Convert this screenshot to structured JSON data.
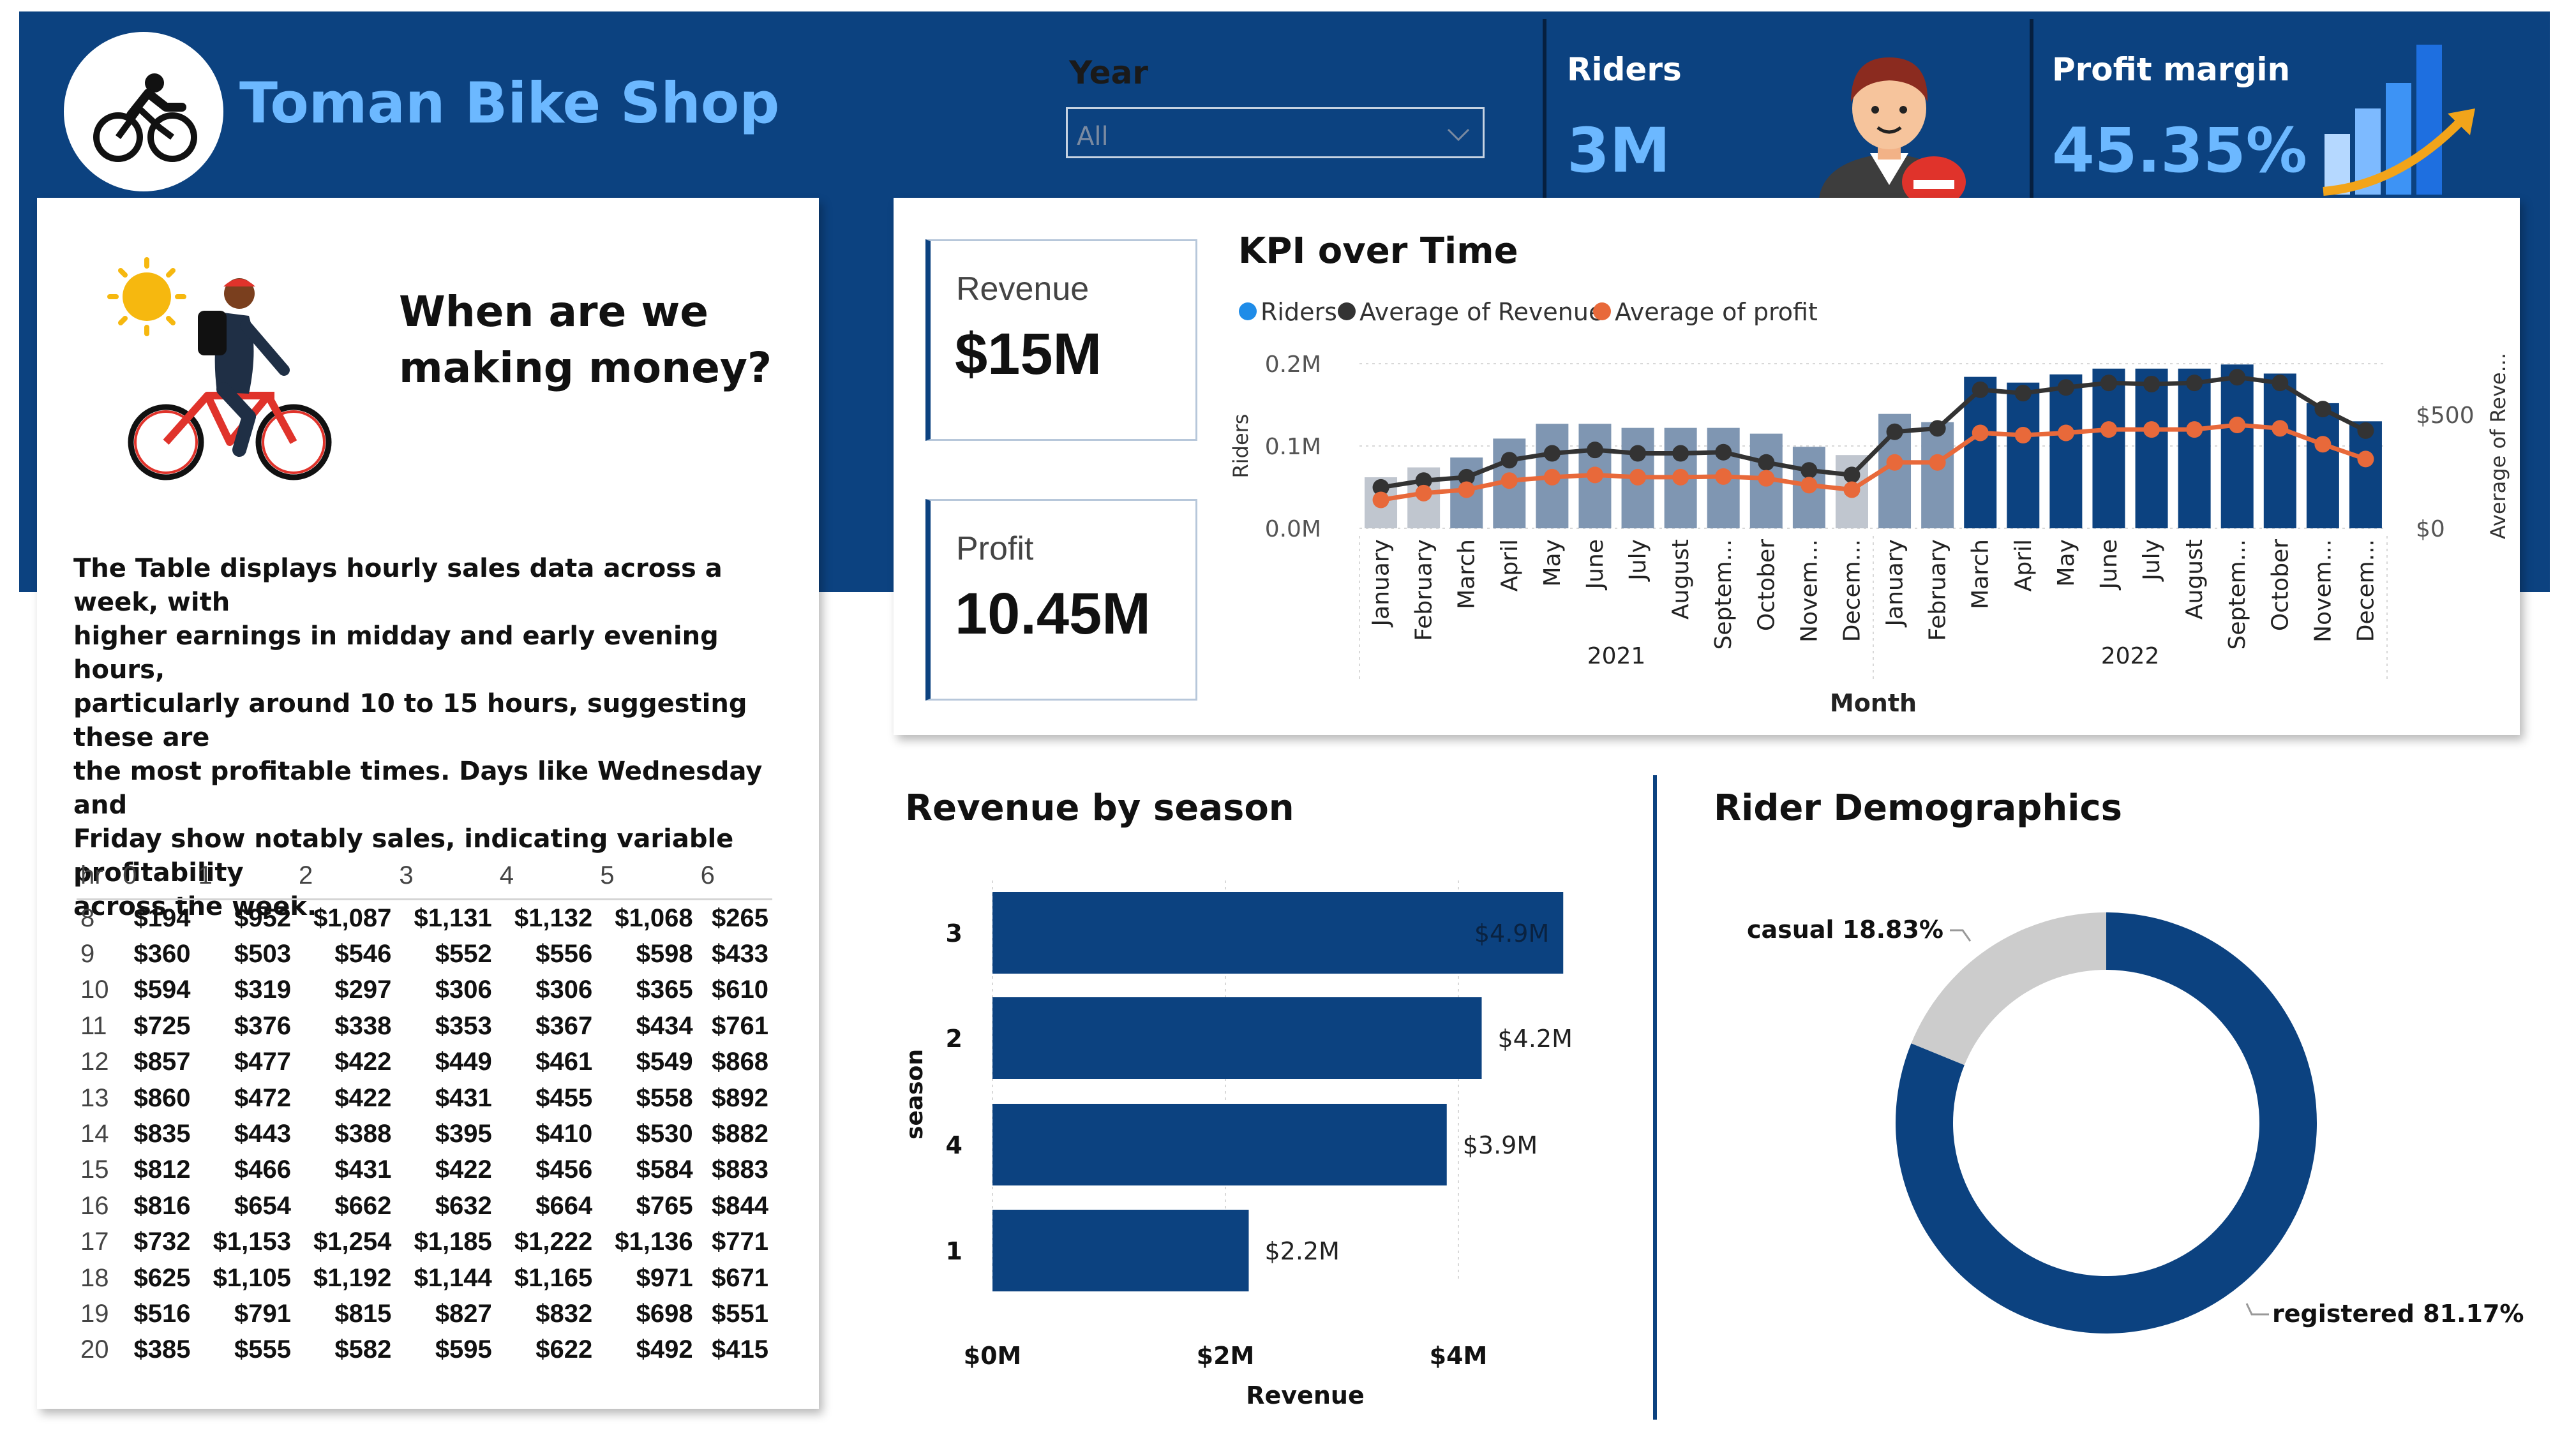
{
  "app": {
    "title": "Toman Bike Shop"
  },
  "slicer": {
    "label": "Year",
    "value": "All"
  },
  "kpis": {
    "riders": {
      "title": "Riders",
      "value": "3M"
    },
    "profit_margin": {
      "title": "Profit margin",
      "value": "45.35%"
    },
    "revenue": {
      "title": "Revenue",
      "value": "$15M"
    },
    "profit": {
      "title": "Profit",
      "value": "10.45M"
    }
  },
  "left_panel": {
    "heading_line1": "When are we",
    "heading_line2": "making money?",
    "description": [
      "The Table displays hourly sales data across a week, with",
      "higher earnings in midday and early evening hours,",
      "particularly around 10 to 15 hours, suggesting these are",
      "the most profitable times. Days like Wednesday and",
      "Friday show notably sales, indicating variable profitability",
      "across the week."
    ]
  },
  "hourly_table": {
    "header": [
      "hr",
      "0",
      "1",
      "2",
      "3",
      "4",
      "5",
      "6"
    ],
    "rows": [
      [
        "8",
        "$194",
        "$952",
        "$1,087",
        "$1,131",
        "$1,132",
        "$1,068",
        "$265"
      ],
      [
        "9",
        "$360",
        "$503",
        "$546",
        "$552",
        "$556",
        "$598",
        "$433"
      ],
      [
        "10",
        "$594",
        "$319",
        "$297",
        "$306",
        "$306",
        "$365",
        "$610"
      ],
      [
        "11",
        "$725",
        "$376",
        "$338",
        "$353",
        "$367",
        "$434",
        "$761"
      ],
      [
        "12",
        "$857",
        "$477",
        "$422",
        "$449",
        "$461",
        "$549",
        "$868"
      ],
      [
        "13",
        "$860",
        "$472",
        "$422",
        "$431",
        "$455",
        "$558",
        "$892"
      ],
      [
        "14",
        "$835",
        "$443",
        "$388",
        "$395",
        "$410",
        "$530",
        "$882"
      ],
      [
        "15",
        "$812",
        "$466",
        "$431",
        "$422",
        "$456",
        "$584",
        "$883"
      ],
      [
        "16",
        "$816",
        "$654",
        "$662",
        "$632",
        "$664",
        "$765",
        "$844"
      ],
      [
        "17",
        "$732",
        "$1,153",
        "$1,254",
        "$1,185",
        "$1,222",
        "$1,136",
        "$771"
      ],
      [
        "18",
        "$625",
        "$1,105",
        "$1,192",
        "$1,144",
        "$1,165",
        "$971",
        "$671"
      ],
      [
        "19",
        "$516",
        "$791",
        "$815",
        "$827",
        "$832",
        "$698",
        "$551"
      ],
      [
        "20",
        "$385",
        "$555",
        "$582",
        "$595",
        "$622",
        "$492",
        "$415"
      ]
    ]
  },
  "chart_data": [
    {
      "type": "bar+line",
      "title": "KPI over Time",
      "legend": [
        "Riders",
        "Average of Revenue",
        "Average of profit"
      ],
      "legend_position": "top-left",
      "xlabel": "Month",
      "ylabel": "Riders",
      "y2label": "Average of Reve...",
      "y_ticks": [
        "0.0M",
        "0.1M",
        "0.2M"
      ],
      "y2_ticks": [
        "$0",
        "$500"
      ],
      "ylim": [
        0,
        0.2
      ],
      "y2lim": [
        0,
        500
      ],
      "month_labels": [
        "January",
        "February",
        "March",
        "April",
        "May",
        "June",
        "July",
        "August",
        "Septem...",
        "October",
        "Novem...",
        "Decem...",
        "January",
        "February",
        "March",
        "April",
        "May",
        "June",
        "July",
        "August",
        "Septem...",
        "October",
        "Novem...",
        "Decem..."
      ],
      "years": [
        "2021",
        "2022"
      ],
      "riders": [
        0.062,
        0.074,
        0.086,
        0.109,
        0.127,
        0.127,
        0.122,
        0.122,
        0.122,
        0.115,
        0.099,
        0.089,
        0.139,
        0.129,
        0.184,
        0.177,
        0.187,
        0.194,
        0.194,
        0.194,
        0.199,
        0.188,
        0.152,
        0.13
      ],
      "average_revenue": [
        180,
        210,
        225,
        300,
        330,
        345,
        330,
        330,
        335,
        290,
        255,
        235,
        425,
        440,
        610,
        595,
        620,
        640,
        635,
        640,
        665,
        640,
        525,
        430
      ],
      "average_profit": [
        125,
        155,
        170,
        210,
        225,
        235,
        225,
        225,
        228,
        220,
        190,
        170,
        290,
        290,
        420,
        410,
        420,
        435,
        435,
        435,
        455,
        440,
        370,
        305
      ],
      "colors": {
        "riders_2021": "#7f96b2",
        "riders_2022": "#0c4280",
        "riders_jan": "#c0c6cf",
        "revenue": "#333333",
        "profit": "#e8693a"
      }
    },
    {
      "type": "bar",
      "orientation": "horizontal",
      "title": "Revenue by season",
      "categories": [
        "3",
        "2",
        "4",
        "1"
      ],
      "values": [
        4.9,
        4.2,
        3.9,
        2.2
      ],
      "value_labels": [
        "$4.9M",
        "$4.2M",
        "$3.9M",
        "$2.2M"
      ],
      "xlabel": "Revenue",
      "ylabel": "season",
      "x_ticks": [
        "$0M",
        "$2M",
        "$4M"
      ],
      "xlim": [
        0,
        5
      ],
      "color": "#0c4280"
    },
    {
      "type": "pie",
      "subtype": "donut",
      "title": "Rider Demographics",
      "labels": [
        "registered",
        "casual"
      ],
      "values": [
        81.17,
        18.83
      ],
      "slice_labels": [
        "registered 81.17%",
        "casual 18.83%"
      ],
      "colors": [
        "#0c4280",
        "#cccccc"
      ]
    }
  ]
}
